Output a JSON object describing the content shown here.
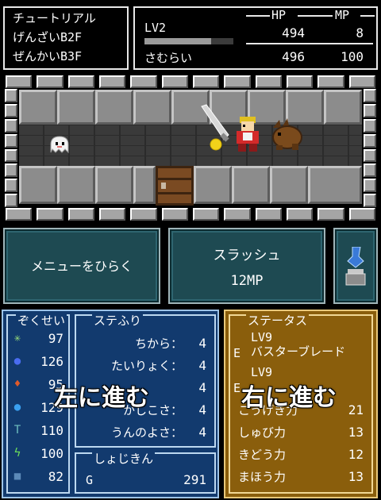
{
  "location": {
    "dungeon": "チュートリアル",
    "current_floor": "げんざいB2F",
    "max_floor": "ぜんかいB3F"
  },
  "party": {
    "hp_header": "HP",
    "mp_header": "MP",
    "level": "LV2",
    "name": "さむらい",
    "hp_current": "494",
    "mp_current": "8",
    "hp_max": "496",
    "mp_max": "100",
    "exp_fraction": 0.75
  },
  "buttons": {
    "menu": "メニューをひらく",
    "skill_name": "スラッシュ",
    "skill_cost": "12MP"
  },
  "attributes": {
    "title": "ぞくせい",
    "items": [
      {
        "icon": "sparkle-icon",
        "value": "97"
      },
      {
        "icon": "octopus-icon",
        "value": "126"
      },
      {
        "icon": "fire-icon",
        "value": "95"
      },
      {
        "icon": "water-drop-icon",
        "value": "129"
      },
      {
        "icon": "hammer-icon",
        "value": "110"
      },
      {
        "icon": "lightning-icon",
        "value": "100"
      },
      {
        "icon": "block-icon",
        "value": "82"
      }
    ]
  },
  "stat_points": {
    "title": "ステふり",
    "rows": [
      {
        "label": "ちから：",
        "value": "4"
      },
      {
        "label": "たいりょく：",
        "value": "4"
      },
      {
        "label": "",
        "value": "4"
      },
      {
        "label": "かしこさ：",
        "value": "4"
      },
      {
        "label": "うんのよさ：",
        "value": "4"
      }
    ]
  },
  "money": {
    "title": "しょじきん",
    "currency": "G",
    "amount": "291"
  },
  "status": {
    "title": "ステータス",
    "equip1_level": "LV9",
    "equip1_mark": "E",
    "equip1_name": "バスターブレード",
    "equip2_level": "LV9",
    "equip2_mark": "E",
    "rows": [
      {
        "label": "こうげき力",
        "value": "21"
      },
      {
        "label": "しゅび力",
        "value": "13"
      },
      {
        "label": "きどう力",
        "value": "12"
      },
      {
        "label": "まほう力",
        "value": "13"
      }
    ]
  },
  "overlays": {
    "left": "左に進む",
    "right": "右に進む"
  },
  "colors": {
    "dungeon_wall": "#9a9a9a",
    "button_bg": "#1e4a52",
    "left_panel": "#123a6e",
    "right_panel": "#8a5e0c"
  }
}
